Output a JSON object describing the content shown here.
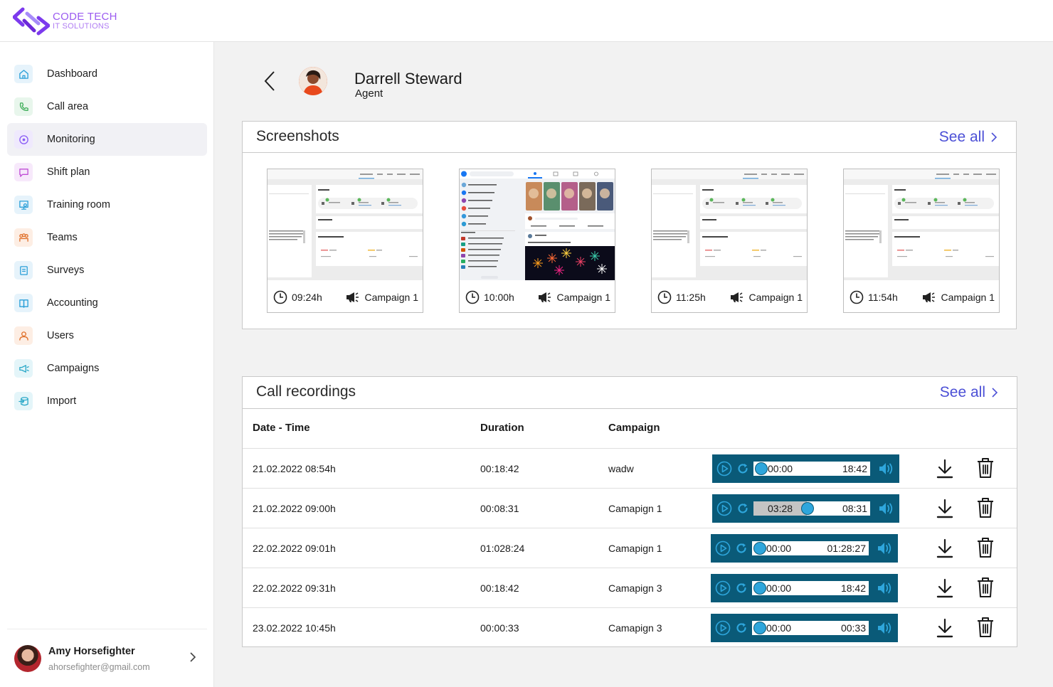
{
  "brand": {
    "line1": "CODE TECH",
    "line2": "IT SOLUTIONS"
  },
  "sidebar": {
    "items": [
      {
        "label": "Dashboard",
        "icon": "home-icon",
        "color": "#2a9fd8",
        "bg": "#e6f3fb"
      },
      {
        "label": "Call area",
        "icon": "phone-icon",
        "color": "#3fae5a",
        "bg": "#e8f6ec"
      },
      {
        "label": "Monitoring",
        "icon": "monitoring-icon",
        "color": "#8b5cf6",
        "bg": "#efe9fd",
        "active": true
      },
      {
        "label": "Shift plan",
        "icon": "chat-icon",
        "color": "#c04fd6",
        "bg": "#f7e9fb"
      },
      {
        "label": "Training room",
        "icon": "training-icon",
        "color": "#2a9fd8",
        "bg": "#e6f3fb"
      },
      {
        "label": "Teams",
        "icon": "teams-icon",
        "color": "#e0702a",
        "bg": "#fdeee4"
      },
      {
        "label": "Surveys",
        "icon": "survey-icon",
        "color": "#2a9fd8",
        "bg": "#e6f3fb"
      },
      {
        "label": "Accounting",
        "icon": "book-icon",
        "color": "#2a9fd8",
        "bg": "#e6f3fb"
      },
      {
        "label": "Users",
        "icon": "user-icon",
        "color": "#e0702a",
        "bg": "#fdeee4"
      },
      {
        "label": "Campaigns",
        "icon": "megaphone-icon",
        "color": "#2aa8c8",
        "bg": "#e4f5f9"
      },
      {
        "label": "Import",
        "icon": "import-icon",
        "color": "#2aa8c8",
        "bg": "#e4f5f9"
      }
    ],
    "user": {
      "name": "Amy Horsefighter",
      "email": "ahorsefighter@gmail.com"
    }
  },
  "agent": {
    "name": "Darrell Steward",
    "role": "Agent"
  },
  "screenshots": {
    "title": "Screenshots",
    "see_all": "See all",
    "items": [
      {
        "time": "09:24h",
        "campaign": "Campaign 1",
        "kind": "settings"
      },
      {
        "time": "10:00h",
        "campaign": "Campaign 1",
        "kind": "feed"
      },
      {
        "time": "11:25h",
        "campaign": "Campaign 1",
        "kind": "settings"
      },
      {
        "time": "11:54h",
        "campaign": "Campaign 1",
        "kind": "settings"
      }
    ]
  },
  "recordings": {
    "title": "Call recordings",
    "see_all": "See all",
    "headers": {
      "datetime": "Date - Time",
      "duration": "Duration",
      "campaign": "Campaign"
    },
    "rows": [
      {
        "datetime": "21.02.2022 08:54h",
        "duration": "00:18:42",
        "campaign": "wadw",
        "current": "00:00",
        "total": "18:42",
        "progress": 0.0
      },
      {
        "datetime": "21.02.2022 09:00h",
        "duration": "00:08:31",
        "campaign": "Camapign 1",
        "current": "03:28",
        "total": "08:31",
        "progress": 0.41
      },
      {
        "datetime": "22.02.2022 09:01h",
        "duration": "01:028:24",
        "campaign": "Camapign 1",
        "current": "00:00",
        "total": "01:28:27",
        "progress": 0.0
      },
      {
        "datetime": "22.02.2022 09:31h",
        "duration": "00:18:42",
        "campaign": "Camapign 3",
        "current": "00:00",
        "total": "18:42",
        "progress": 0.0
      },
      {
        "datetime": "23.02.2022 10:45h",
        "duration": "00:00:33",
        "campaign": "Camapign 3",
        "current": "00:00",
        "total": "00:33",
        "progress": 0.0
      }
    ]
  },
  "colors": {
    "accent": "#4b4fd6",
    "player": "#0a5a78",
    "knob": "#2ea6dc"
  }
}
